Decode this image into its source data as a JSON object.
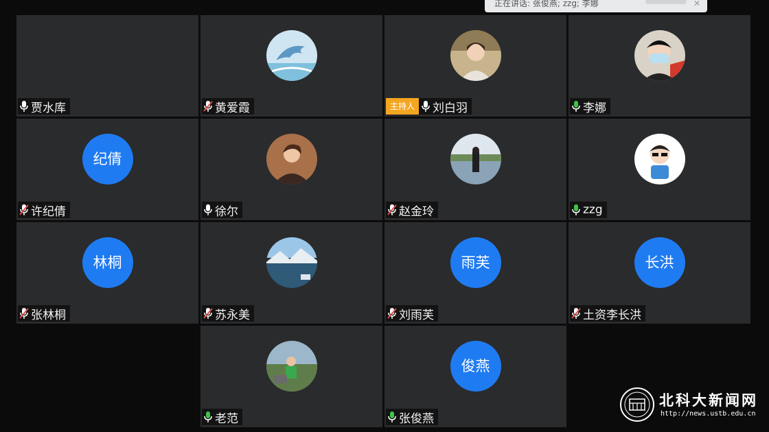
{
  "notification": {
    "text": "正在讲话: 张俊燕; zzg; 李娜",
    "close": "✕"
  },
  "host_badge": "主持人",
  "participants": [
    {
      "name": "贾水库",
      "mic": "active",
      "avatar": "none",
      "initials": ""
    },
    {
      "name": "黄爱霞",
      "mic": "muted",
      "avatar": "dolphin",
      "initials": ""
    },
    {
      "name": "刘白羽",
      "mic": "active",
      "avatar": "photo-woman",
      "initials": "",
      "host": true
    },
    {
      "name": "李娜",
      "mic": "speaking",
      "avatar": "photo-mask",
      "initials": ""
    },
    {
      "name": "许纪倩",
      "mic": "muted",
      "avatar": "initials",
      "initials": "纪倩"
    },
    {
      "name": "徐尔",
      "mic": "active",
      "avatar": "photo-portrait",
      "initials": ""
    },
    {
      "name": "赵金玲",
      "mic": "muted",
      "avatar": "photo-lake",
      "initials": ""
    },
    {
      "name": "zzg",
      "mic": "speaking",
      "avatar": "cartoon",
      "initials": ""
    },
    {
      "name": "张林桐",
      "mic": "muted",
      "avatar": "initials",
      "initials": "林桐"
    },
    {
      "name": "苏永美",
      "mic": "muted",
      "avatar": "landscape",
      "initials": ""
    },
    {
      "name": "刘雨芙",
      "mic": "muted",
      "avatar": "initials",
      "initials": "雨芙"
    },
    {
      "name": "土资李长洪",
      "mic": "muted",
      "avatar": "initials",
      "initials": "长洪"
    },
    {
      "name": "老范",
      "mic": "speaking",
      "avatar": "photo-outdoor",
      "initials": ""
    },
    {
      "name": "张俊燕",
      "mic": "speaking",
      "avatar": "initials",
      "initials": "俊燕"
    }
  ],
  "watermark": {
    "brand": "北科大新闻网",
    "url": "http://news.ustb.edu.cn"
  },
  "colors": {
    "tile": "#2a2b2d",
    "avatar_blue": "#1f7bf2",
    "host_badge": "#f4a620",
    "speaking": "#3fc34a",
    "muted": "#e04848"
  }
}
